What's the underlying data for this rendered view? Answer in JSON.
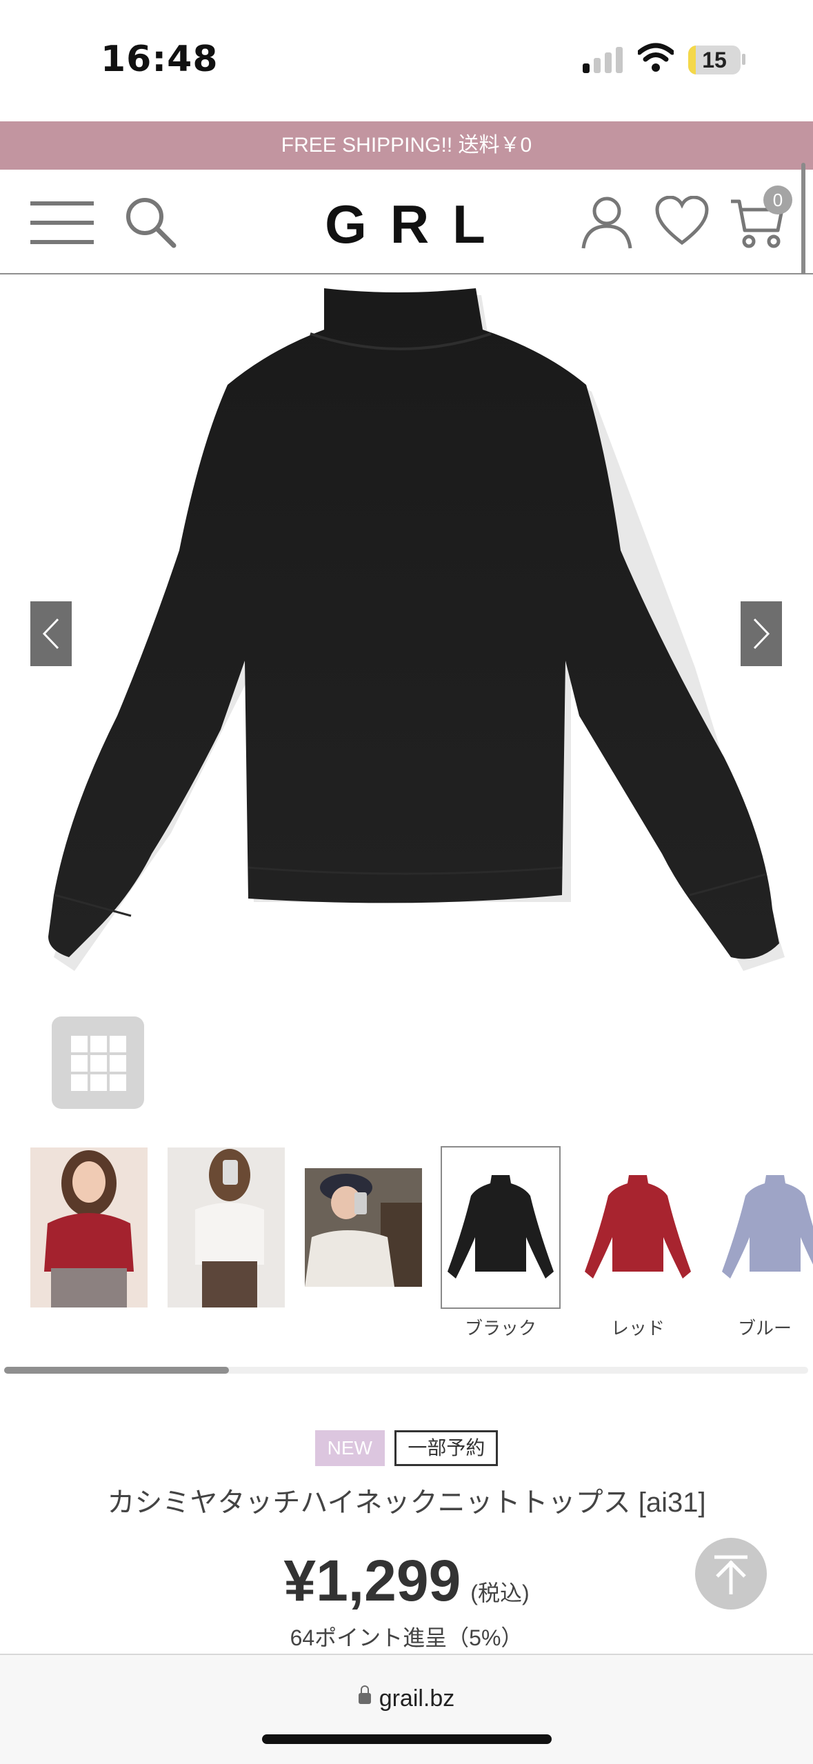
{
  "status_bar": {
    "time": "16:48",
    "battery": "15",
    "battery_level": 0.15
  },
  "banner": {
    "text": "FREE SHIPPING!! 送料￥0"
  },
  "header": {
    "logo": "GRL",
    "cart_count": "0",
    "icons": [
      "menu-icon",
      "search-icon",
      "user-icon",
      "heart-icon",
      "cart-icon"
    ]
  },
  "gallery": {
    "prev_icon": "chevron-left-icon",
    "next_icon": "chevron-right-icon",
    "grid_icon": "grid-icon"
  },
  "thumbnails": [
    {
      "label": "",
      "kind": "model-red"
    },
    {
      "label": "",
      "kind": "model-white"
    },
    {
      "label": "",
      "kind": "model-hat"
    },
    {
      "label": "ブラック",
      "kind": "black",
      "selected": true
    },
    {
      "label": "レッド",
      "kind": "red"
    },
    {
      "label": "ブルー",
      "kind": "blue"
    }
  ],
  "product": {
    "badge_new": "NEW",
    "badge_partial": "一部予約",
    "name": "カシミヤタッチハイネックニットトップス [ai31]",
    "price": "¥1,299",
    "tax": "(税込)",
    "points": "64ポイント進呈（5%）"
  },
  "browser": {
    "url": "grail.bz"
  },
  "colors": {
    "banner": "#c295a0",
    "badge_new": "#dcc6df",
    "sweater": "#1d1d1d",
    "red": "#a8242f",
    "blue": "#9ea4c6"
  }
}
